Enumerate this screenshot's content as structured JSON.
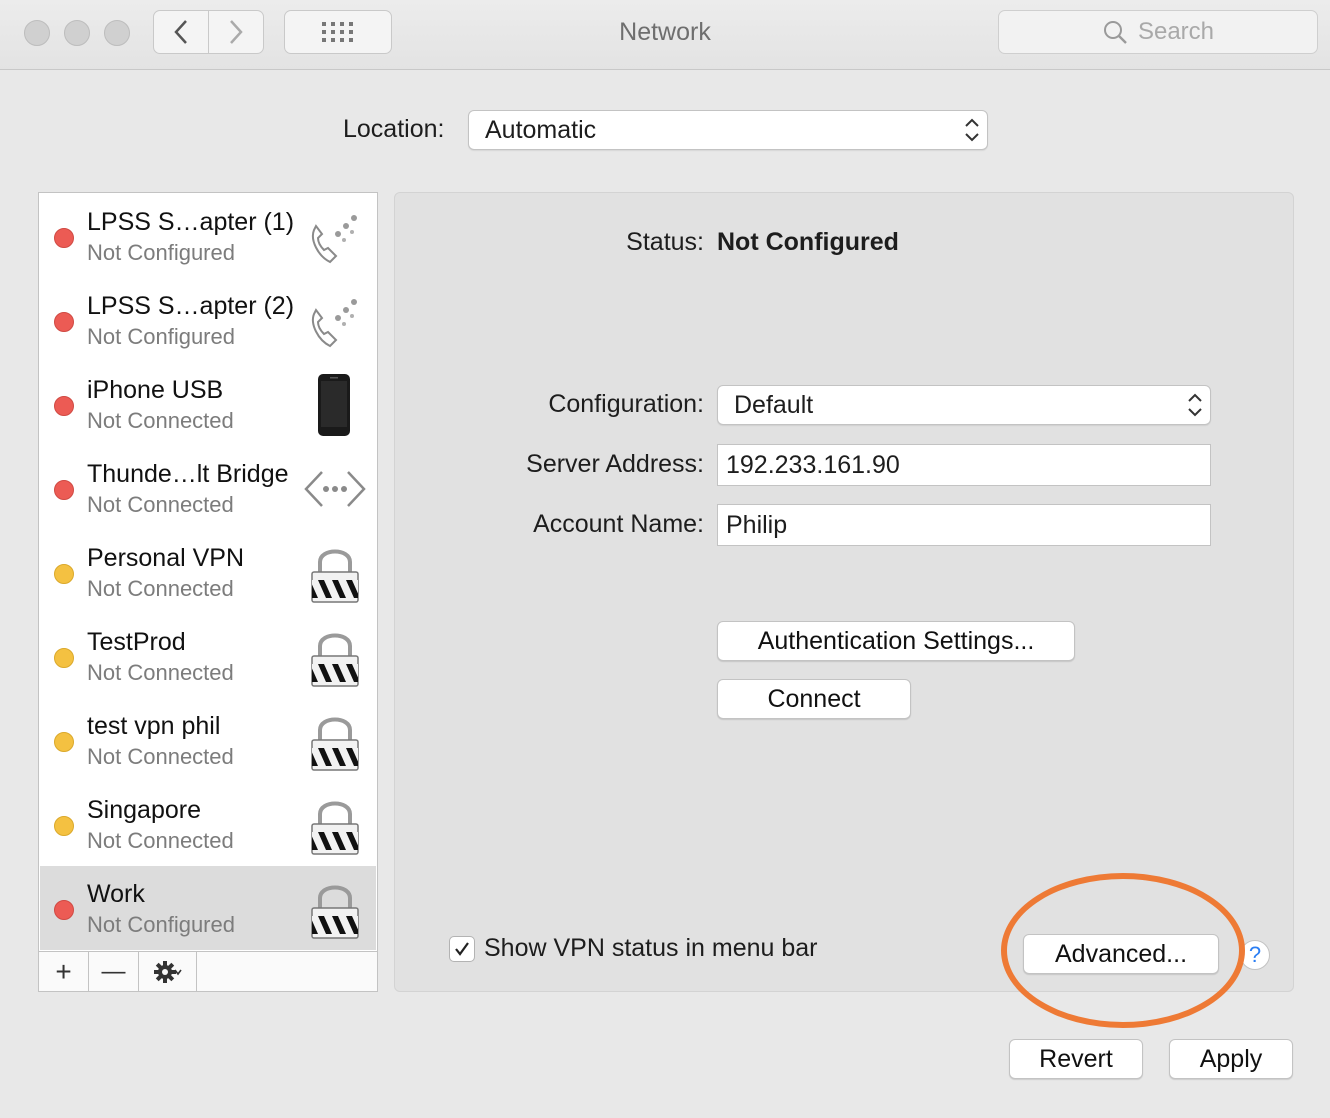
{
  "window": {
    "title": "Network"
  },
  "toolbar": {
    "back_glyph": "‹",
    "forward_glyph": "›",
    "search_placeholder": "Search"
  },
  "location": {
    "label": "Location:",
    "value": "Automatic"
  },
  "services": [
    {
      "name": "LPSS S…apter (1)",
      "status": "Not Configured",
      "dot": "red",
      "icon": "modem-phone-icon"
    },
    {
      "name": "LPSS S…apter (2)",
      "status": "Not Configured",
      "dot": "red",
      "icon": "modem-phone-icon"
    },
    {
      "name": "iPhone USB",
      "status": "Not Connected",
      "dot": "red",
      "icon": "iphone-icon"
    },
    {
      "name": "Thunde…lt Bridge",
      "status": "Not Connected",
      "dot": "red",
      "icon": "bridge-arrows-icon"
    },
    {
      "name": "Personal VPN",
      "status": "Not Connected",
      "dot": "yellow",
      "icon": "vpn-lock-icon"
    },
    {
      "name": "TestProd",
      "status": "Not Connected",
      "dot": "yellow",
      "icon": "vpn-lock-icon"
    },
    {
      "name": "test vpn phil",
      "status": "Not Connected",
      "dot": "yellow",
      "icon": "vpn-lock-icon"
    },
    {
      "name": "Singapore",
      "status": "Not Connected",
      "dot": "yellow",
      "icon": "vpn-lock-icon"
    },
    {
      "name": "Work",
      "status": "Not Configured",
      "dot": "red",
      "icon": "vpn-lock-icon",
      "selected": true
    }
  ],
  "sidebar_actions": {
    "add": "+",
    "remove": "—"
  },
  "detail": {
    "status_label": "Status:",
    "status_value": "Not Configured",
    "configuration_label": "Configuration:",
    "configuration_value": "Default",
    "server_label": "Server Address:",
    "server_value": "192.233.161.90",
    "account_label": "Account Name:",
    "account_value": "Philip",
    "auth_button": "Authentication Settings...",
    "connect_button": "Connect",
    "show_status_label": "Show VPN status in menu bar",
    "show_status_checked": true,
    "advanced_button": "Advanced...",
    "help_glyph": "?"
  },
  "footer": {
    "revert_button": "Revert",
    "apply_button": "Apply"
  },
  "colors": {
    "dot_red": "#ec5b54",
    "dot_yellow": "#f4c141",
    "highlight": "#ee7a35",
    "help_blue": "#2b7ef3"
  }
}
